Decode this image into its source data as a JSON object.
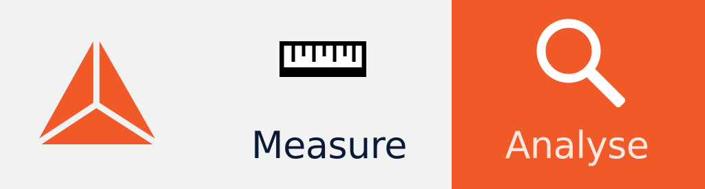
{
  "app": {
    "logo_icon": "triangle-logo-icon",
    "accent_color": "#f05a28",
    "background_color": "#f2f2f2"
  },
  "toolbar": {
    "items": [
      {
        "label": "Measure",
        "icon": "ruler-icon",
        "selected": false
      },
      {
        "label": "Analyse",
        "icon": "magnifier-icon",
        "selected": true
      }
    ]
  }
}
